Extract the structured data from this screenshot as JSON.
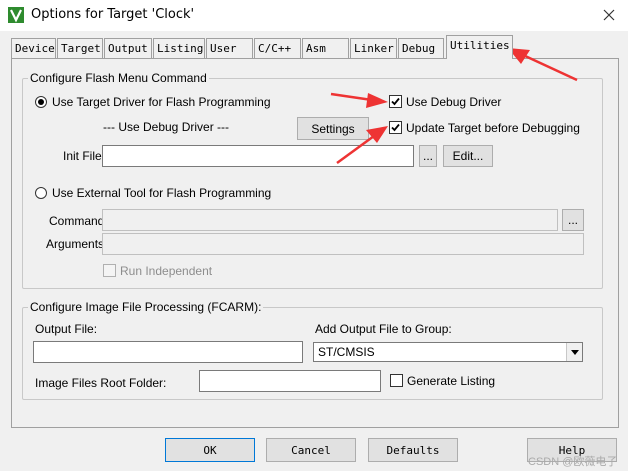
{
  "window": {
    "title": "Options for Target 'Clock'"
  },
  "tabs": [
    "Device",
    "Target",
    "Output",
    "Listing",
    "User",
    "C/C++",
    "Asm",
    "Linker",
    "Debug",
    "Utilities"
  ],
  "flash": {
    "legend": "Configure Flash Menu Command",
    "use_target_driver": "Use Target Driver for Flash Programming",
    "use_debug_driver_note": "--- Use Debug Driver ---",
    "settings": "Settings",
    "use_debug_driver": "Use Debug Driver",
    "update_target": "Update Target before Debugging",
    "init_file_label": "Init File:",
    "init_file_value": "",
    "browse": "...",
    "edit": "Edit...",
    "use_external_tool": "Use External Tool for Flash Programming",
    "command_label": "Command:",
    "arguments_label": "Arguments:",
    "run_independent": "Run Independent"
  },
  "image": {
    "legend": "Configure Image File Processing (FCARM):",
    "output_file_label": "Output File:",
    "output_file_value": "",
    "add_output_label": "Add Output File  to Group:",
    "group_value": "ST/CMSIS",
    "root_folder_label": "Image Files Root Folder:",
    "root_folder_value": "",
    "generate_listing": "Generate Listing"
  },
  "buttons": {
    "ok": "OK",
    "cancel": "Cancel",
    "defaults": "Defaults",
    "help": "Help"
  },
  "watermark": "CSDN @欧薇电子",
  "colors": {
    "annotation_arrow": "#ee3333",
    "default_button_border": "#0078d7"
  }
}
